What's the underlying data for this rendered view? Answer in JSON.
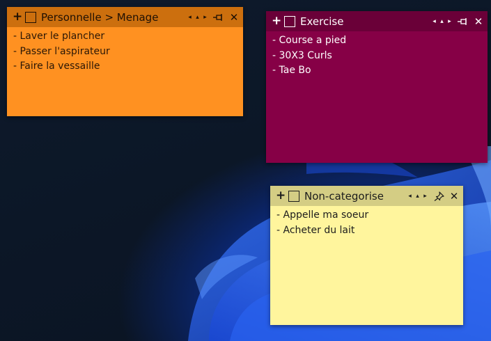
{
  "notes": [
    {
      "id": "orange",
      "color": "#ff9121",
      "title": "Personnelle > Menage",
      "controls": {
        "add": "+",
        "prev": "◂",
        "up": "▴",
        "next": "▸",
        "close": "✕",
        "pin_state": "unpinned"
      },
      "lines": [
        "- Laver le plancher",
        "- Passer l'aspirateur",
        "- Faire la vessaille"
      ]
    },
    {
      "id": "magenta",
      "color": "#860046",
      "title": "Exercise",
      "controls": {
        "add": "+",
        "prev": "◂",
        "up": "▴",
        "next": "▸",
        "close": "✕",
        "pin_state": "unpinned"
      },
      "lines": [
        "- Course a pied",
        "- 30X3 Curls",
        "- Tae Bo"
      ]
    },
    {
      "id": "yellow",
      "color": "#fff59d",
      "title": "Non-categorise",
      "controls": {
        "add": "+",
        "prev": "◂",
        "up": "▴",
        "next": "▸",
        "close": "✕",
        "pin_state": "pinned"
      },
      "lines": [
        "- Appelle ma soeur",
        "- Acheter du lait"
      ]
    }
  ]
}
